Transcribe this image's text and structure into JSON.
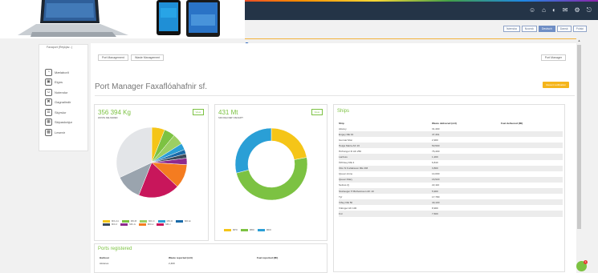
{
  "header": {
    "icons": [
      "user-icon",
      "home-icon",
      "gauge-icon",
      "mail-icon",
      "settings-icon",
      "logout-icon"
    ],
    "languages": [
      {
        "label": "Íslenska",
        "active": false
      },
      {
        "label": "Noorsk",
        "active": false
      },
      {
        "label": "Deutsch",
        "active": true
      },
      {
        "label": "Dansk",
        "active": false
      },
      {
        "label": "Polski",
        "active": false
      }
    ]
  },
  "sidebar": {
    "port_label": "Faxaport (Reykjav...)",
    "items": [
      {
        "label": "Mælaborð",
        "icon": "gauge-icon"
      },
      {
        "label": "Eigns",
        "icon": "building-icon"
      },
      {
        "label": "Notendur",
        "icon": "user-icon"
      },
      {
        "label": "Gagnalindir",
        "icon": "tools-icon"
      },
      {
        "label": "Skýrslur",
        "icon": "document-icon"
      },
      {
        "label": "Skipaskrájur",
        "icon": "table-icon"
      },
      {
        "label": "Lesenir",
        "icon": "grid-icon"
      }
    ]
  },
  "toolbar": {
    "port_management": "Port Management",
    "waste_management": "Waste Management",
    "port_manager": "Port Manager"
  },
  "page": {
    "title": "Port Manager Faxaflóahafnir sf.",
    "badge": "Recent notification"
  },
  "colors": {
    "accent_green": "#7cc242",
    "badge_orange": "#f5b51b",
    "topbar": "#243447"
  },
  "cards": {
    "waste": {
      "value": "356 394 Kg",
      "subtitle": "WASTE DELIVERED",
      "view": "View",
      "legend": [
        "MIC-A1",
        "MIC-B",
        "MIC-C",
        "MIC-D",
        "MIC-E",
        "MIC-F",
        "MIC-G",
        "MIC-H",
        "MIC-I"
      ]
    },
    "delivery": {
      "value": "431 Mt",
      "subtitle": "SDN DELIVERY RECEIPT",
      "view": "View",
      "legend": [
        "MPO",
        "MBO",
        "MDO"
      ]
    }
  },
  "chart_data": [
    {
      "type": "pie",
      "title": "356 394 Kg",
      "subtitle": "WASTE DELIVERED",
      "categories": [
        "MIC-A1",
        "MIC-B",
        "MIC-C",
        "MIC-D",
        "MIC-E",
        "MIC-F",
        "MIC-G",
        "MIC-H",
        "MIC-I",
        "",
        ""
      ],
      "values": [
        6,
        5,
        5,
        3,
        2,
        2,
        3,
        11,
        19,
        12,
        32
      ],
      "colors": [
        "#f5c518",
        "#7cc242",
        "#9ccf63",
        "#2a9fd6",
        "#1a6aa8",
        "#3c4a5a",
        "#8e2a8e",
        "#f47c20",
        "#c8165b",
        "#9aa4ae",
        "#e3e5e8"
      ]
    },
    {
      "type": "pie",
      "title": "431 Mt",
      "subtitle": "SDN DELIVERY RECEIPT",
      "categories": [
        "MPO",
        "MBO",
        "MDO"
      ],
      "values": [
        22,
        49,
        29
      ],
      "colors": [
        "#f5c518",
        "#7cc242",
        "#2a9fd6"
      ]
    }
  ],
  "ships": {
    "title": "Ships",
    "columns": [
      "Ship",
      "Waste delivered (m3)",
      "Fuel delivered (Mt)"
    ],
    "rows": [
      [
        "Akurey",
        "31,400",
        ""
      ],
      [
        "Engey RE 91",
        "47,461",
        ""
      ],
      [
        "Gunnar Mon",
        "2,900",
        ""
      ],
      [
        "Helga María AK 16",
        "50,500",
        ""
      ],
      [
        "Höfrungur III AK 250",
        "76,400",
        ""
      ],
      [
        "Lanfoss",
        "1,200",
        ""
      ],
      [
        "Örfirisey RE 4",
        "6,810",
        ""
      ],
      [
        "Ottó N Þorláksson RE 203",
        "3,800",
        ""
      ],
      [
        "Queen Anne",
        "14,000",
        ""
      ],
      [
        "Queen Mary",
        "16,520",
        ""
      ],
      [
        "Sefoss (I)",
        "22,110",
        ""
      ],
      [
        "Sturlaugur H Böðvarsson AK 10",
        "5,900",
        ""
      ],
      [
        "Týr",
        "17,780",
        ""
      ],
      [
        "Viðey RE 50",
        "40,100",
        ""
      ],
      [
        "Víkingur AK 100",
        "8,900",
        ""
      ],
      [
        "Þór",
        "7,600",
        ""
      ]
    ]
  },
  "ports": {
    "title": "Ports registered",
    "columns": [
      "Harbour",
      "Waste reported (m3)",
      "Fuel reported (Mt)"
    ],
    "rows": [
      [
        "Akranes",
        "2,400",
        ""
      ]
    ]
  }
}
